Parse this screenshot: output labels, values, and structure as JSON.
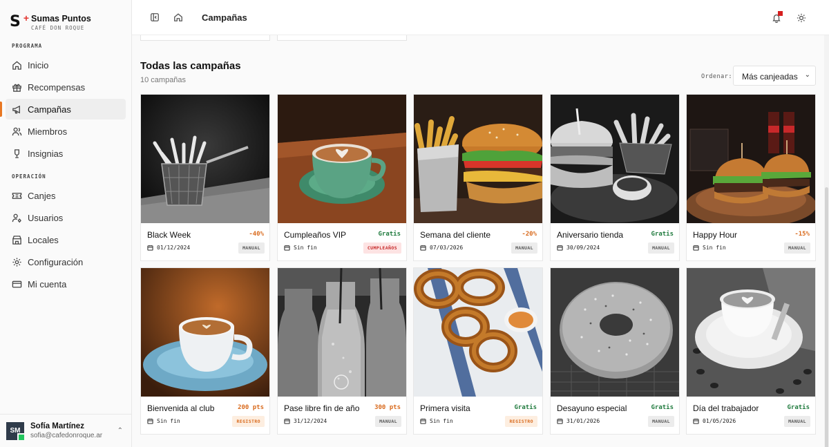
{
  "brand": {
    "name": "Sumas Puntos",
    "subtitle": "CAFÉ DON ROQUE"
  },
  "sidebar": {
    "section1": "PROGRAMA",
    "items1": [
      {
        "label": "Inicio",
        "icon": "home-icon"
      },
      {
        "label": "Recompensas",
        "icon": "gift-icon"
      },
      {
        "label": "Campañas",
        "icon": "megaphone-icon",
        "active": true
      },
      {
        "label": "Miembros",
        "icon": "users-icon"
      },
      {
        "label": "Insignias",
        "icon": "trophy-icon"
      }
    ],
    "section2": "OPERACIÓN",
    "items2": [
      {
        "label": "Canjes",
        "icon": "ticket-icon"
      },
      {
        "label": "Usuarios",
        "icon": "user-cog-icon"
      },
      {
        "label": "Locales",
        "icon": "store-icon"
      },
      {
        "label": "Configuración",
        "icon": "gear-icon"
      },
      {
        "label": "Mi cuenta",
        "icon": "card-icon"
      }
    ]
  },
  "user": {
    "initials": "SM",
    "name": "Sofía Martínez",
    "email": "sofia@cafedonroque.ar"
  },
  "topbar": {
    "title": "Campañas"
  },
  "main": {
    "heading": "Todas las campañas",
    "count": "10 campañas",
    "sort_label": "Ordenar:",
    "sort_value": "Más canjeadas"
  },
  "campaigns": [
    {
      "title": "Black Week",
      "value": "-40%",
      "value_color": "#d96b1e",
      "date": "01/12/2024",
      "badge": "MANUAL",
      "badge_type": "manual",
      "photo": "fries-bw"
    },
    {
      "title": "Cumpleaños VIP",
      "value": "Gratis",
      "value_color": "#1f7a3d",
      "date": "Sin fin",
      "badge": "CUMPLEAÑOS",
      "badge_type": "bday",
      "photo": "latte-green"
    },
    {
      "title": "Semana del cliente",
      "value": "-20%",
      "value_color": "#d96b1e",
      "date": "07/03/2026",
      "badge": "MANUAL",
      "badge_type": "manual",
      "photo": "burger-fries"
    },
    {
      "title": "Aniversario tienda",
      "value": "Gratis",
      "value_color": "#1f7a3d",
      "date": "30/09/2024",
      "badge": "MANUAL",
      "badge_type": "manual",
      "photo": "burger-bw"
    },
    {
      "title": "Happy Hour",
      "value": "-15%",
      "value_color": "#d96b1e",
      "date": "Sin fin",
      "badge": "MANUAL",
      "badge_type": "manual",
      "photo": "burgers-cola"
    },
    {
      "title": "Bienvenida al club",
      "value": "200 pts",
      "value_color": "#d96b1e",
      "date": "Sin fin",
      "badge": "REGISTRO",
      "badge_type": "reg",
      "photo": "coffee-blue"
    },
    {
      "title": "Pase libre fin de año",
      "value": "300 pts",
      "value_color": "#d96b1e",
      "date": "31/12/2024",
      "badge": "MANUAL",
      "badge_type": "manual",
      "photo": "bottles-bw"
    },
    {
      "title": "Primera visita",
      "value": "Gratis",
      "value_color": "#1f7a3d",
      "date": "Sin fin",
      "badge": "REGISTRO",
      "badge_type": "reg",
      "photo": "onion-rings"
    },
    {
      "title": "Desayuno especial",
      "value": "Gratis",
      "value_color": "#1f7a3d",
      "date": "31/01/2026",
      "badge": "MANUAL",
      "badge_type": "manual",
      "photo": "bagel-bw"
    },
    {
      "title": "Día del trabajador",
      "value": "Gratis",
      "value_color": "#1f7a3d",
      "date": "01/05/2026",
      "badge": "MANUAL",
      "badge_type": "manual",
      "photo": "latte-bw"
    }
  ]
}
